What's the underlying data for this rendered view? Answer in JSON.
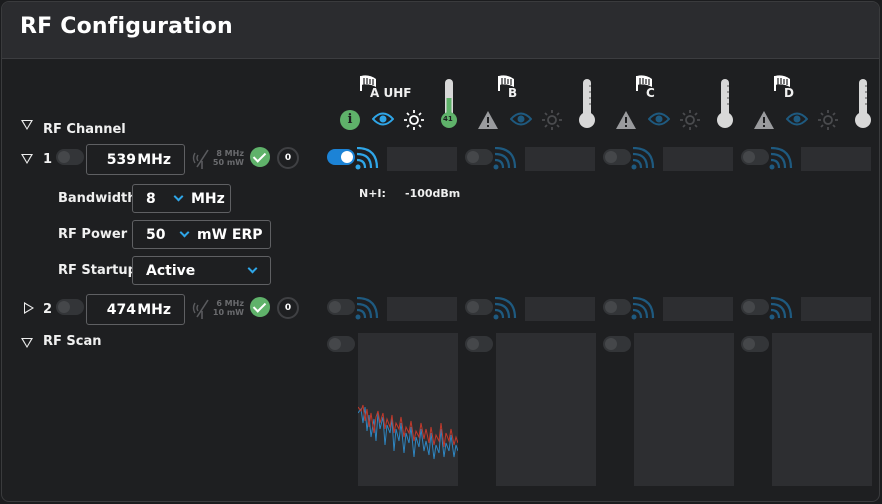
{
  "title": "RF Configuration",
  "rf_channel_label": "RF Channel",
  "rf_scan_label": "RF Scan",
  "channels": [
    {
      "number": "1",
      "frequency": "539",
      "unit": "MHz",
      "spec_bw": "8 MHz",
      "spec_pwr": "50 mW",
      "count": "0"
    },
    {
      "number": "2",
      "frequency": "474",
      "unit": "MHz",
      "spec_bw": "6 MHz",
      "spec_pwr": "10 mW",
      "count": "0"
    }
  ],
  "settings": {
    "bandwidth_label": "Bandwidth",
    "bandwidth_value": "8",
    "bandwidth_unit": "MHz",
    "power_label": "RF Power",
    "power_value": "50",
    "power_unit": "mW ERP",
    "startup_label": "RF Startup",
    "startup_value": "Active"
  },
  "antennas": [
    {
      "name": "A UHF",
      "temperature": "41",
      "temp_level": 0.42
    },
    {
      "name": "B",
      "temp_level": 0
    },
    {
      "name": "C",
      "temp_level": 0
    },
    {
      "name": "D",
      "temp_level": 0
    }
  ],
  "noise": {
    "label": "N+I:",
    "value": "-100dBm"
  },
  "colors": {
    "accent": "#1c83d6",
    "ok": "#5fb26a",
    "warn_icon": "#5a5b5e",
    "scan_red": "#c0392b",
    "scan_blue": "#2e86c1"
  },
  "icons": [
    "antenna-icon",
    "info-icon",
    "eye-icon",
    "sun-icon",
    "warning-icon",
    "thermometer-icon",
    "signal-icon",
    "check-icon",
    "chevron-down-icon",
    "collapse-icon",
    "expand-icon"
  ]
}
